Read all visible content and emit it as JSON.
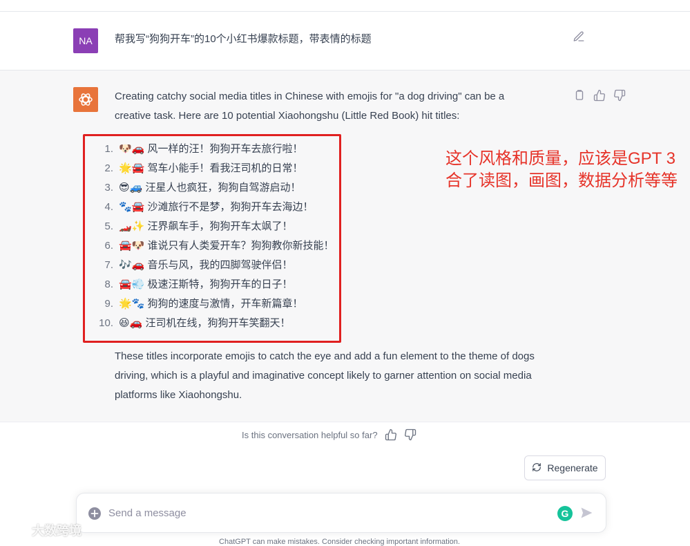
{
  "user_message": {
    "avatar_initials": "NA",
    "text": "帮我写“狗狗开车”的10个小红书爆款标题，带表情的标题"
  },
  "assistant_message": {
    "intro": "Creating catchy social media titles in Chinese with emojis for \"a dog driving\" can be a creative task. Here are 10 potential Xiaohongshu (Little Red Book) hit titles:",
    "titles": [
      {
        "num": "1.",
        "text": "🐶🚗 风一样的汪！狗狗开车去旅行啦！"
      },
      {
        "num": "2.",
        "text": "🌟🚘 驾车小能手！看我汪司机的日常！"
      },
      {
        "num": "3.",
        "text": "😎🚙 汪星人也疯狂，狗狗自驾游启动！"
      },
      {
        "num": "4.",
        "text": "🐾🚘 沙滩旅行不是梦，狗狗开车去海边！"
      },
      {
        "num": "5.",
        "text": "🏎️✨ 汪界飙车手，狗狗开车太飒了！"
      },
      {
        "num": "6.",
        "text": "🚘🐶 谁说只有人类爱开车？狗狗教你新技能！"
      },
      {
        "num": "7.",
        "text": "🎶🚗 音乐与风，我的四脚驾驶伴侣！"
      },
      {
        "num": "8.",
        "text": "🚘💨 极速汪斯特，狗狗开车的日子！"
      },
      {
        "num": "9.",
        "text": "🌟🐾 狗狗的速度与激情，开车新篇章！"
      },
      {
        "num": "10.",
        "text": "😆🚗 汪司机在线，狗狗开车笑翻天！"
      }
    ],
    "outro": "These titles incorporate emojis to catch the eye and add a fun element to the theme of dogs driving, which is a playful and imaginative concept likely to garner attention on social media platforms like Xiaohongshu."
  },
  "annotation": {
    "line1": "这个风格和质量，应该是GPT 3",
    "line2": "合了读图，画图，数据分析等等"
  },
  "feedback": {
    "question": "Is this conversation helpful so far?"
  },
  "regenerate_label": "Regenerate",
  "composer": {
    "placeholder": "Send a message",
    "grammarly_letter": "G"
  },
  "disclaimer": "ChatGPT can make mistakes. Consider checking important information.",
  "watermark": "大数跨境",
  "colors": {
    "user_avatar": "#8b3fb5",
    "gpt_avatar": "#e8743b",
    "highlight_box": "#e02020",
    "annotation_text": "#e63329",
    "grammarly": "#15c39a"
  }
}
